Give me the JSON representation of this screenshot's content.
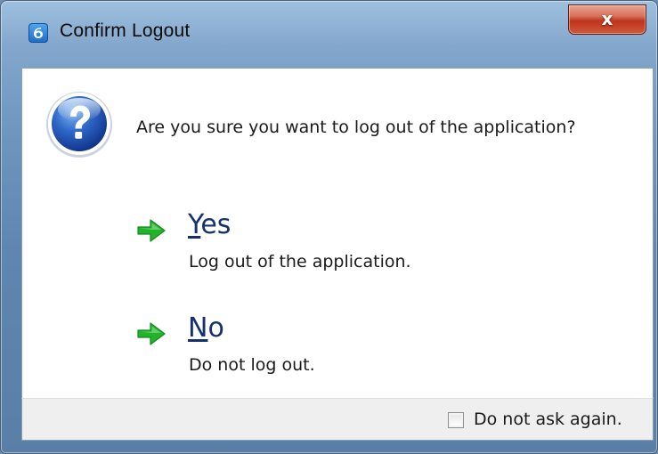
{
  "window": {
    "title": "Confirm Logout",
    "close_symbol": "x",
    "app_icon": "app-logo-icon"
  },
  "dialog": {
    "icon": "question-icon",
    "message": "Are you sure you want to log out of the application?",
    "options": [
      {
        "mnemonic": "Y",
        "label_rest": "es",
        "description": "Log out of the application.",
        "icon": "green-arrow-icon"
      },
      {
        "mnemonic": "N",
        "label_rest": "o",
        "description": "Do not log out.",
        "icon": "green-arrow-icon"
      }
    ]
  },
  "footer": {
    "checkbox_label": "Do not ask again.",
    "checkbox_checked": false
  },
  "colors": {
    "accent_blue": "#15306e",
    "arrow_green": "#22b22b",
    "close_red": "#c0341c"
  }
}
